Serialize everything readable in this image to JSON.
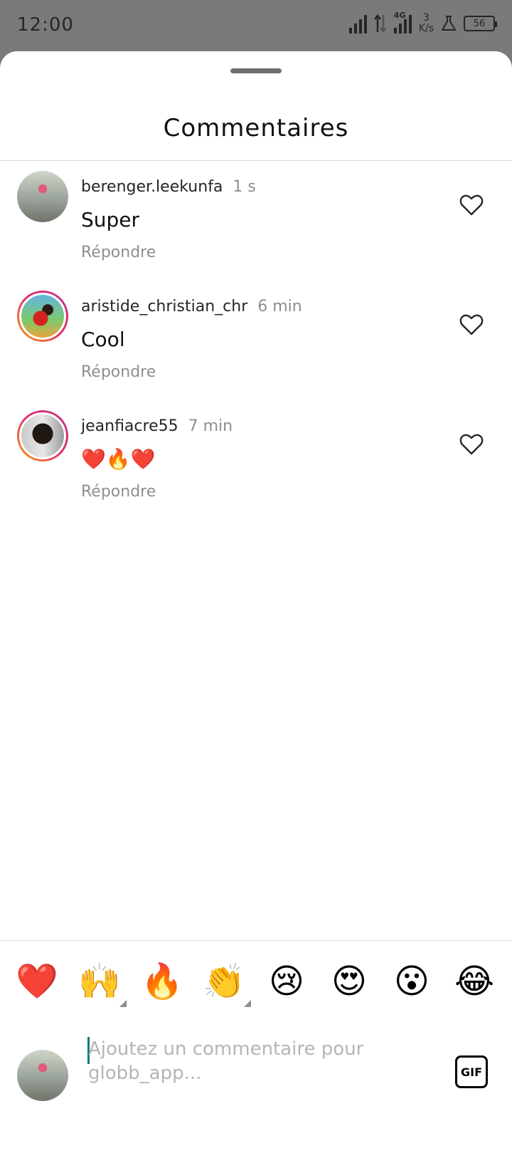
{
  "status_bar": {
    "time": "12:00",
    "network_type": "4G",
    "speed_value": "3",
    "speed_unit": "K/s",
    "battery": "56",
    "icons": [
      "signal-icon",
      "data-transfer-icon",
      "signal-4g-icon",
      "lab-flask-icon",
      "battery-icon"
    ]
  },
  "sheet": {
    "title": "Commentaires"
  },
  "comments": [
    {
      "username": "berenger.leekunfa",
      "time": "1 s",
      "text": "Super",
      "reply_label": "Répondre"
    },
    {
      "username": "aristide_christian_chr",
      "time": "6 min",
      "text": "Cool",
      "reply_label": "Répondre"
    },
    {
      "username": "jeanfiacre55",
      "time": "7 min",
      "text": "❤️🔥❤️",
      "reply_label": "Répondre"
    }
  ],
  "emoji_bar": [
    "❤️",
    "🙌",
    "🔥",
    "👏",
    "😢",
    "😍",
    "😮",
    "😂"
  ],
  "composer": {
    "placeholder": "Ajoutez un commentaire pour globb_app...",
    "gif_label": "GIF"
  },
  "colors": {
    "accent_caret": "#0c7d70",
    "secondary_text": "#8e8e8e",
    "story_ring": "#e1306c"
  }
}
